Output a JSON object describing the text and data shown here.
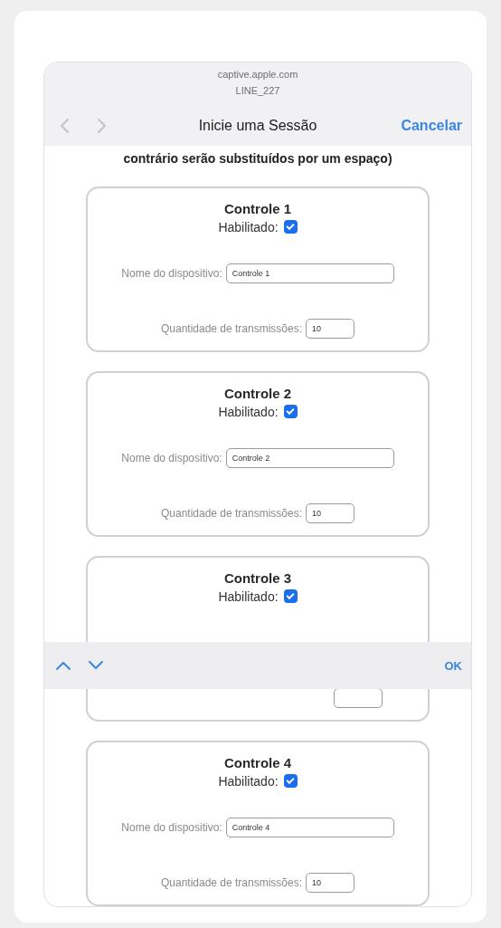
{
  "browser": {
    "domain": "captive.apple.com",
    "network": "LINE_227",
    "title": "Inicie uma Sessão",
    "cancel": "Cancelar"
  },
  "intro_text": "contrário serão substituídos por um espaço)",
  "cards": [
    {
      "title": "Controle 1",
      "enabled_label": "Habilitado:",
      "enabled": true,
      "name_label": "Nome do dispositivo:",
      "name_value": "Controle 1",
      "count_label": "Quantidade de transmissões:",
      "count_value": "10"
    },
    {
      "title": "Controle 2",
      "enabled_label": "Habilitado:",
      "enabled": true,
      "name_label": "Nome do dispositivo:",
      "name_value": "Controle 2",
      "count_label": "Quantidade de transmissões:",
      "count_value": "10"
    },
    {
      "title": "Controle 3",
      "enabled_label": "Habilitado:",
      "enabled": true
    },
    {
      "title": "Controle 4",
      "enabled_label": "Habilitado:",
      "enabled": true,
      "name_label": "Nome do dispositivo:",
      "name_value": "Controle 4",
      "count_label": "Quantidade de transmissões:",
      "count_value": "10"
    }
  ],
  "keyboard_bar": {
    "done": "OK"
  }
}
